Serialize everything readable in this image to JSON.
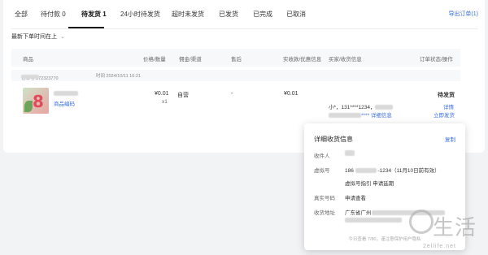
{
  "tabs": [
    {
      "label": "全部"
    },
    {
      "label": "待付款 0"
    },
    {
      "label": "待发货 1"
    },
    {
      "label": "24小时待发货"
    },
    {
      "label": "超时未发货"
    },
    {
      "label": "已发货"
    },
    {
      "label": "已完成"
    },
    {
      "label": "已取消"
    }
  ],
  "export_label": "导出订单(1)",
  "sort_label": "最新下单时间在上",
  "table": {
    "headers": [
      "商品",
      "价格/数量",
      "佣金/渠道",
      "售后",
      "实收款/优惠信息",
      "买家/收货信息",
      "订单状态/操作"
    ]
  },
  "order": {
    "order_no_prefix": "订单号 372323770",
    "time_label": "时间 2024/10/11 16:21",
    "product_link": "商品编码",
    "price": "¥0.01",
    "qty": "x1",
    "channel": "自营",
    "aftersale": "-",
    "received": "¥0.01",
    "buyer_line": "小*，131****1234，",
    "buyer_line2_suffix": "**** 详细信息",
    "status": "待发货",
    "actions": [
      "详情",
      "立即发货"
    ]
  },
  "popup": {
    "title": "详细收货信息",
    "copy_label": "复制",
    "rows": {
      "receiver_label": "收件人",
      "virtual_label": "虚拟号",
      "virtual_value_prefix": "186",
      "virtual_value_suffix": "-1234（11月10日前有效）",
      "virtual_links": "虚拟号指引   申请延期",
      "real_label": "真实号码",
      "real_link": "申请查看",
      "addr_label": "收货地址",
      "addr_value_prefix": "广东省广州"
    },
    "footer": "今日查看 7/80，谨注意保护用户隐私"
  },
  "watermark": {
    "text": "生活",
    "url": "2ellife.net"
  },
  "colors": {
    "link": "#3a6fe0",
    "panel_bg": "#ffffff",
    "page_bg": "#f2f3f5"
  }
}
